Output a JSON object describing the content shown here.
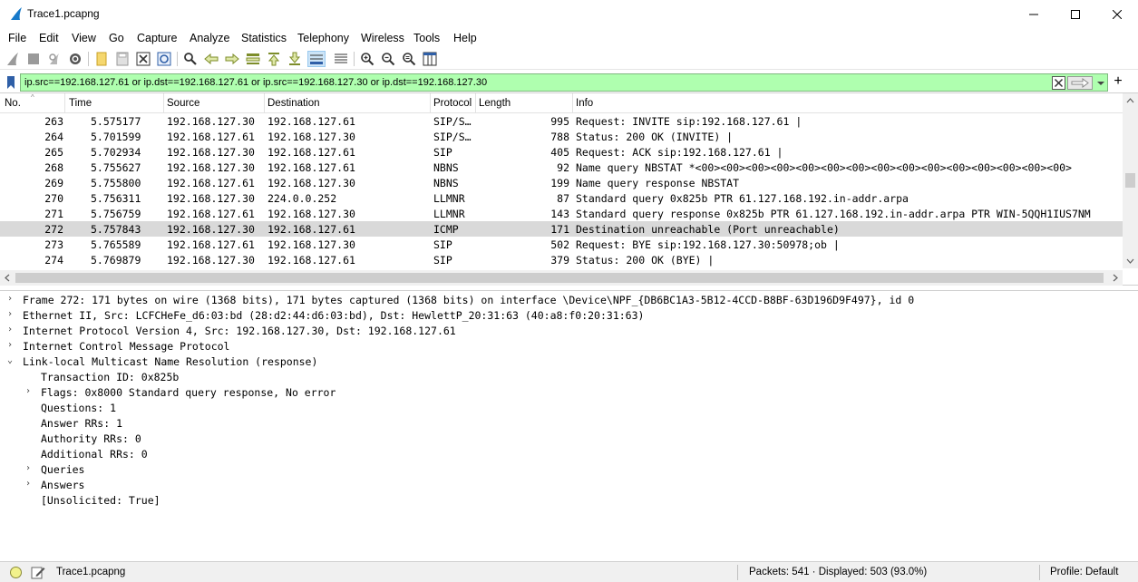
{
  "window": {
    "title": "Trace1.pcapng",
    "minimize_icon": "minimize-icon",
    "maximize_icon": "maximize-icon",
    "close_icon": "close-icon"
  },
  "menu": [
    "File",
    "Edit",
    "View",
    "Go",
    "Capture",
    "Analyze",
    "Statistics",
    "Telephony",
    "Wireless",
    "Tools",
    "Help"
  ],
  "toolbar": {
    "icons": [
      "shark-fin-start-icon",
      "stop-icon",
      "restart-icon",
      "options-gear-icon",
      "open-folder-icon",
      "save-file-icon",
      "close-file-icon",
      "reload-icon",
      "find-packet-icon",
      "go-back-icon",
      "go-forward-icon",
      "go-to-packet-icon",
      "go-first-icon",
      "go-last-icon",
      "autoscroll-icon",
      "colorize-icon",
      "zoom-in-icon",
      "zoom-out-icon",
      "zoom-normal-icon",
      "resize-columns-icon"
    ]
  },
  "filter": {
    "value": "ip.src==192.168.127.61 or ip.dst==192.168.127.61  or ip.src==192.168.127.30  or ip.dst==192.168.127.30",
    "background": "#afffaf"
  },
  "packet_list": {
    "columns": [
      "No.",
      "Time",
      "Source",
      "Destination",
      "Protocol",
      "Length",
      "Info"
    ],
    "rows": [
      {
        "no": "263",
        "time": "5.575177",
        "src": "192.168.127.30",
        "dst": "192.168.127.61",
        "proto": "SIP/S…",
        "len": "995",
        "info": "Request: INVITE sip:192.168.127.61 |"
      },
      {
        "no": "264",
        "time": "5.701599",
        "src": "192.168.127.61",
        "dst": "192.168.127.30",
        "proto": "SIP/S…",
        "len": "788",
        "info": "Status: 200 OK (INVITE) |"
      },
      {
        "no": "265",
        "time": "5.702934",
        "src": "192.168.127.30",
        "dst": "192.168.127.61",
        "proto": "SIP",
        "len": "405",
        "info": "Request: ACK sip:192.168.127.61 |"
      },
      {
        "no": "268",
        "time": "5.755627",
        "src": "192.168.127.30",
        "dst": "192.168.127.61",
        "proto": "NBNS",
        "len": "92",
        "info": "Name query NBSTAT *<00><00><00><00><00><00><00><00><00><00><00><00><00><00><00>"
      },
      {
        "no": "269",
        "time": "5.755800",
        "src": "192.168.127.61",
        "dst": "192.168.127.30",
        "proto": "NBNS",
        "len": "199",
        "info": "Name query response NBSTAT"
      },
      {
        "no": "270",
        "time": "5.756311",
        "src": "192.168.127.30",
        "dst": "224.0.0.252",
        "proto": "LLMNR",
        "len": "87",
        "info": "Standard query 0x825b PTR 61.127.168.192.in-addr.arpa"
      },
      {
        "no": "271",
        "time": "5.756759",
        "src": "192.168.127.61",
        "dst": "192.168.127.30",
        "proto": "LLMNR",
        "len": "143",
        "info": "Standard query response 0x825b PTR 61.127.168.192.in-addr.arpa PTR WIN-5QQH1IUS7NM"
      },
      {
        "no": "272",
        "time": "5.757843",
        "src": "192.168.127.30",
        "dst": "192.168.127.61",
        "proto": "ICMP",
        "len": "171",
        "info": "Destination unreachable (Port unreachable)",
        "selected": true
      },
      {
        "no": "273",
        "time": "5.765589",
        "src": "192.168.127.61",
        "dst": "192.168.127.30",
        "proto": "SIP",
        "len": "502",
        "info": "Request: BYE sip:192.168.127.30:50978;ob |"
      },
      {
        "no": "274",
        "time": "5.769879",
        "src": "192.168.127.30",
        "dst": "192.168.127.61",
        "proto": "SIP",
        "len": "379",
        "info": "Status: 200 OK (BYE) |"
      }
    ]
  },
  "details": [
    {
      "toggle": "›",
      "indent": 0,
      "text": "Frame 272: 171 bytes on wire (1368 bits), 171 bytes captured (1368 bits) on interface \\Device\\NPF_{DB6BC1A3-5B12-4CCD-B8BF-63D196D9F497}, id 0"
    },
    {
      "toggle": "›",
      "indent": 0,
      "text": "Ethernet II, Src: LCFCHeFe_d6:03:bd (28:d2:44:d6:03:bd), Dst: HewlettP_20:31:63 (40:a8:f0:20:31:63)"
    },
    {
      "toggle": "›",
      "indent": 0,
      "text": "Internet Protocol Version 4, Src: 192.168.127.30, Dst: 192.168.127.61"
    },
    {
      "toggle": "›",
      "indent": 0,
      "text": "Internet Control Message Protocol"
    },
    {
      "toggle": "⌄",
      "indent": 0,
      "text": "Link-local Multicast Name Resolution (response)"
    },
    {
      "toggle": "",
      "indent": 1,
      "text": "Transaction ID: 0x825b"
    },
    {
      "toggle": "›",
      "indent": 1,
      "text": "Flags: 0x8000 Standard query response, No error"
    },
    {
      "toggle": "",
      "indent": 1,
      "text": "Questions: 1"
    },
    {
      "toggle": "",
      "indent": 1,
      "text": "Answer RRs: 1"
    },
    {
      "toggle": "",
      "indent": 1,
      "text": "Authority RRs: 0"
    },
    {
      "toggle": "",
      "indent": 1,
      "text": "Additional RRs: 0"
    },
    {
      "toggle": "›",
      "indent": 1,
      "text": "Queries"
    },
    {
      "toggle": "›",
      "indent": 1,
      "text": "Answers"
    },
    {
      "toggle": "",
      "indent": 1,
      "text": "[Unsolicited: True]"
    }
  ],
  "status": {
    "file": "Trace1.pcapng",
    "packets": "Packets: 541 · Displayed: 503 (93.0%)",
    "profile": "Profile: Default"
  }
}
